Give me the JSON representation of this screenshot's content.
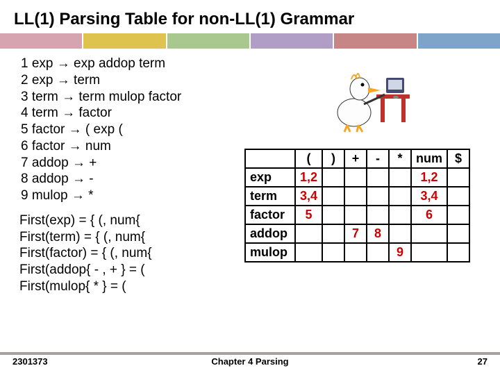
{
  "title": "LL(1) Parsing Table for non-LL(1) Grammar",
  "rules": [
    "1 exp → exp addop term",
    "2 exp → term",
    "3 term → term mulop factor",
    "4 term → factor",
    "5 factor → ( exp (",
    "6 factor → num",
    "7 addop → +",
    "8 addop → -",
    "9 mulop → *"
  ],
  "firsts": [
    "First(exp) = { (, num{",
    "First(term) = { (, num{",
    "First(factor) = { (, num{",
    "First(addop{ - , + } = (",
    "First(mulop{ * } = ("
  ],
  "table": {
    "columns": [
      "(",
      ")",
      "+",
      "-",
      "*",
      "num",
      "$"
    ],
    "rows": [
      {
        "head": "exp",
        "cells": [
          "1,2",
          "",
          "",
          "",
          "",
          "1,2",
          ""
        ]
      },
      {
        "head": "term",
        "cells": [
          "3,4",
          "",
          "",
          "",
          "",
          "3,4",
          ""
        ]
      },
      {
        "head": "factor",
        "cells": [
          "5",
          "",
          "",
          "",
          "",
          "6",
          ""
        ]
      },
      {
        "head": "addop",
        "cells": [
          "",
          "",
          "7",
          "8",
          "",
          "",
          ""
        ]
      },
      {
        "head": "mulop",
        "cells": [
          "",
          "",
          "",
          "",
          "9",
          "",
          ""
        ]
      }
    ]
  },
  "footer": {
    "left": "2301373",
    "center": "Chapter 4   Parsing",
    "right": "27"
  }
}
